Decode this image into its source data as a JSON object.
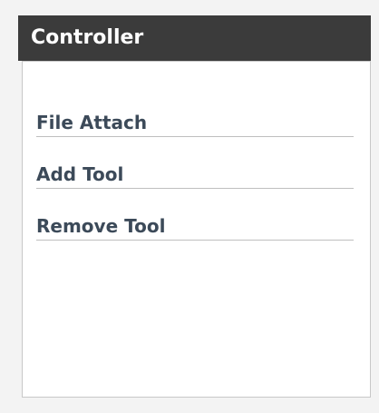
{
  "panel": {
    "title": "Controller",
    "items": [
      {
        "label": "File Attach"
      },
      {
        "label": "Add Tool"
      },
      {
        "label": "Remove Tool"
      }
    ]
  }
}
